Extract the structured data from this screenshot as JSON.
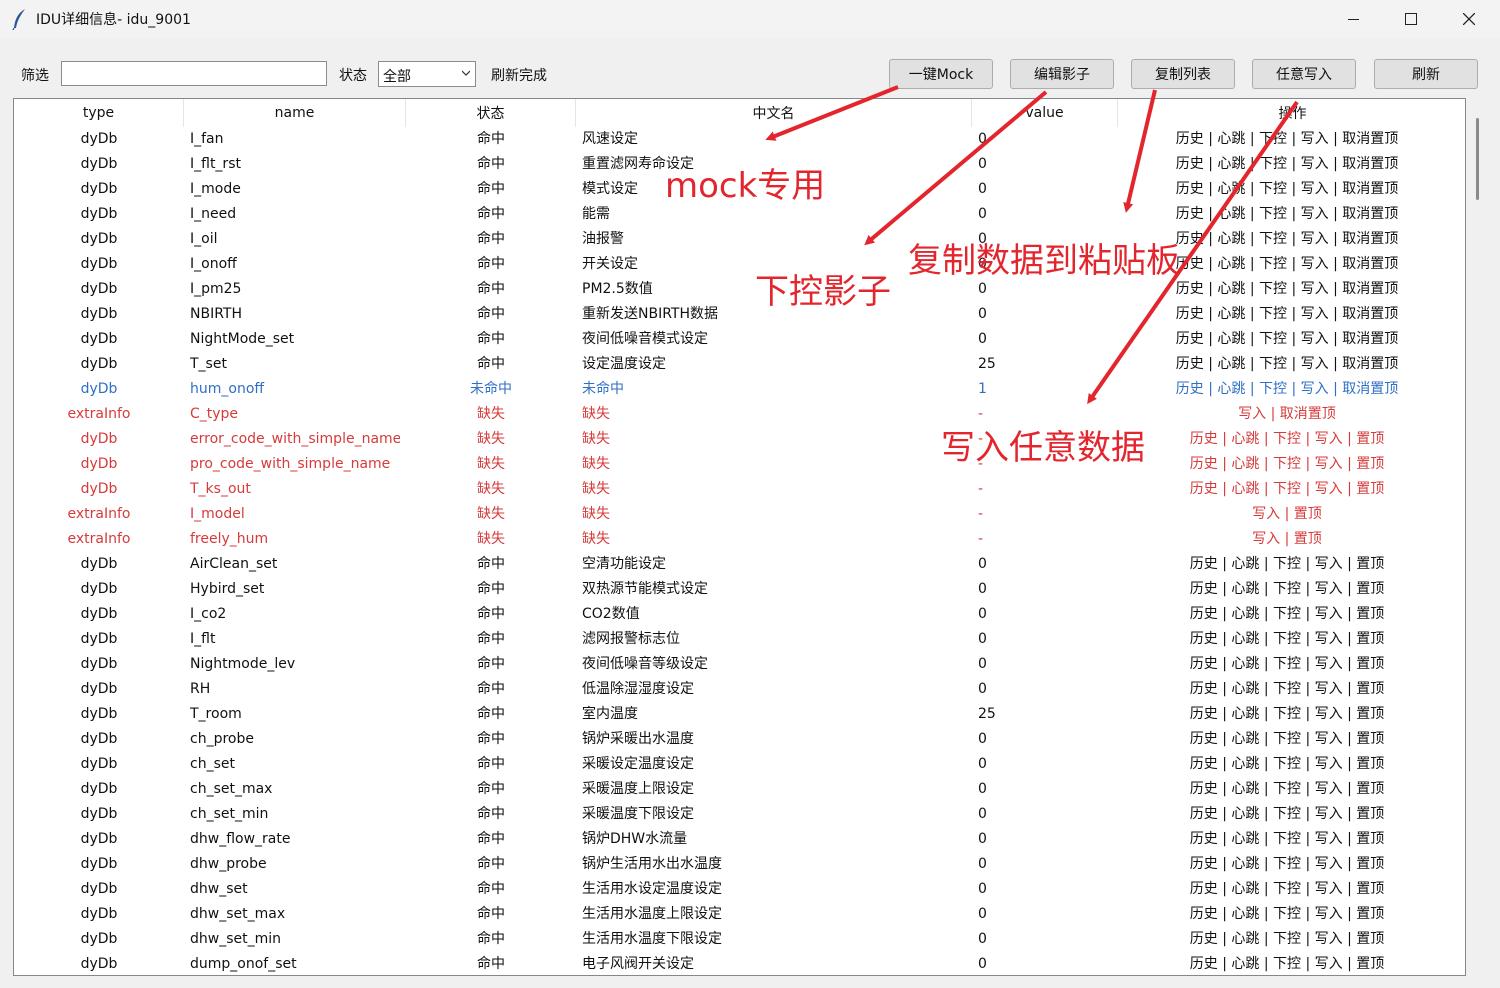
{
  "window": {
    "title": "IDU详细信息- idu_9001"
  },
  "toolbar": {
    "filter_label": "筛选",
    "filter_value": "",
    "state_label": "状态",
    "state_value": "全部",
    "status_text": "刷新完成",
    "buttons": [
      "一键Mock",
      "编辑影子",
      "复制列表",
      "任意写入",
      "刷新"
    ]
  },
  "table": {
    "headers": [
      "type",
      "name",
      "状态",
      "中文名",
      "value",
      "操作"
    ],
    "rows": [
      {
        "type": "dyDb",
        "name": "I_fan",
        "state": "命中",
        "cn": "风速设定",
        "value": "0",
        "ops": "历史 | 心跳 | 下控 | 写入 | 取消置顶",
        "status": "hit"
      },
      {
        "type": "dyDb",
        "name": "I_flt_rst",
        "state": "命中",
        "cn": "重置滤网寿命设定",
        "value": "0",
        "ops": "历史 | 心跳 | 下控 | 写入 | 取消置顶",
        "status": "hit"
      },
      {
        "type": "dyDb",
        "name": "I_mode",
        "state": "命中",
        "cn": "模式设定",
        "value": "0",
        "ops": "历史 | 心跳 | 下控 | 写入 | 取消置顶",
        "status": "hit"
      },
      {
        "type": "dyDb",
        "name": "I_need",
        "state": "命中",
        "cn": "能需",
        "value": "0",
        "ops": "历史 | 心跳 | 下控 | 写入 | 取消置顶",
        "status": "hit"
      },
      {
        "type": "dyDb",
        "name": "I_oil",
        "state": "命中",
        "cn": "油报警",
        "value": "0",
        "ops": "历史 | 心跳 | 下控 | 写入 | 取消置顶",
        "status": "hit"
      },
      {
        "type": "dyDb",
        "name": "I_onoff",
        "state": "命中",
        "cn": "开关设定",
        "value": "0",
        "ops": "历史 | 心跳 | 下控 | 写入 | 取消置顶",
        "status": "hit"
      },
      {
        "type": "dyDb",
        "name": "I_pm25",
        "state": "命中",
        "cn": "PM2.5数值",
        "value": "0",
        "ops": "历史 | 心跳 | 下控 | 写入 | 取消置顶",
        "status": "hit"
      },
      {
        "type": "dyDb",
        "name": "NBIRTH",
        "state": "命中",
        "cn": "重新发送NBIRTH数据",
        "value": "0",
        "ops": "历史 | 心跳 | 下控 | 写入 | 取消置顶",
        "status": "hit"
      },
      {
        "type": "dyDb",
        "name": "NightMode_set",
        "state": "命中",
        "cn": "夜间低噪音模式设定",
        "value": "0",
        "ops": "历史 | 心跳 | 下控 | 写入 | 取消置顶",
        "status": "hit"
      },
      {
        "type": "dyDb",
        "name": "T_set",
        "state": "命中",
        "cn": "设定温度设定",
        "value": "25",
        "ops": "历史 | 心跳 | 下控 | 写入 | 取消置顶",
        "status": "hit"
      },
      {
        "type": "dyDb",
        "name": "hum_onoff",
        "state": "未命中",
        "cn": "未命中",
        "value": "1",
        "ops": "历史 | 心跳 | 下控 | 写入 | 取消置顶",
        "status": "unhit"
      },
      {
        "type": "extraInfo",
        "name": "C_type",
        "state": "缺失",
        "cn": "缺失",
        "value": "-",
        "ops": "写入 | 取消置顶",
        "status": "miss"
      },
      {
        "type": "dyDb",
        "name": "error_code_with_simple_name",
        "state": "缺失",
        "cn": "缺失",
        "value": "-",
        "ops": "历史 | 心跳 | 下控 | 写入 | 置顶",
        "status": "miss"
      },
      {
        "type": "dyDb",
        "name": "pro_code_with_simple_name",
        "state": "缺失",
        "cn": "缺失",
        "value": "-",
        "ops": "历史 | 心跳 | 下控 | 写入 | 置顶",
        "status": "miss"
      },
      {
        "type": "dyDb",
        "name": "T_ks_out",
        "state": "缺失",
        "cn": "缺失",
        "value": "-",
        "ops": "历史 | 心跳 | 下控 | 写入 | 置顶",
        "status": "miss"
      },
      {
        "type": "extraInfo",
        "name": "I_model",
        "state": "缺失",
        "cn": "缺失",
        "value": "-",
        "ops": "写入 | 置顶",
        "status": "miss"
      },
      {
        "type": "extraInfo",
        "name": "freely_hum",
        "state": "缺失",
        "cn": "缺失",
        "value": "-",
        "ops": "写入 | 置顶",
        "status": "miss"
      },
      {
        "type": "dyDb",
        "name": "AirClean_set",
        "state": "命中",
        "cn": "空清功能设定",
        "value": "0",
        "ops": "历史 | 心跳 | 下控 | 写入 | 置顶",
        "status": "hit"
      },
      {
        "type": "dyDb",
        "name": "Hybird_set",
        "state": "命中",
        "cn": "双热源节能模式设定",
        "value": "0",
        "ops": "历史 | 心跳 | 下控 | 写入 | 置顶",
        "status": "hit"
      },
      {
        "type": "dyDb",
        "name": "I_co2",
        "state": "命中",
        "cn": "CO2数值",
        "value": "0",
        "ops": "历史 | 心跳 | 下控 | 写入 | 置顶",
        "status": "hit"
      },
      {
        "type": "dyDb",
        "name": "I_flt",
        "state": "命中",
        "cn": "滤网报警标志位",
        "value": "0",
        "ops": "历史 | 心跳 | 下控 | 写入 | 置顶",
        "status": "hit"
      },
      {
        "type": "dyDb",
        "name": "Nightmode_lev",
        "state": "命中",
        "cn": "夜间低噪音等级设定",
        "value": "0",
        "ops": "历史 | 心跳 | 下控 | 写入 | 置顶",
        "status": "hit"
      },
      {
        "type": "dyDb",
        "name": "RH",
        "state": "命中",
        "cn": "低温除湿湿度设定",
        "value": "0",
        "ops": "历史 | 心跳 | 下控 | 写入 | 置顶",
        "status": "hit"
      },
      {
        "type": "dyDb",
        "name": "T_room",
        "state": "命中",
        "cn": "室内温度",
        "value": "25",
        "ops": "历史 | 心跳 | 下控 | 写入 | 置顶",
        "status": "hit"
      },
      {
        "type": "dyDb",
        "name": "ch_probe",
        "state": "命中",
        "cn": "锅炉采暖出水温度",
        "value": "0",
        "ops": "历史 | 心跳 | 下控 | 写入 | 置顶",
        "status": "hit"
      },
      {
        "type": "dyDb",
        "name": "ch_set",
        "state": "命中",
        "cn": "采暖设定温度设定",
        "value": "0",
        "ops": "历史 | 心跳 | 下控 | 写入 | 置顶",
        "status": "hit"
      },
      {
        "type": "dyDb",
        "name": "ch_set_max",
        "state": "命中",
        "cn": "采暖温度上限设定",
        "value": "0",
        "ops": "历史 | 心跳 | 下控 | 写入 | 置顶",
        "status": "hit"
      },
      {
        "type": "dyDb",
        "name": "ch_set_min",
        "state": "命中",
        "cn": "采暖温度下限设定",
        "value": "0",
        "ops": "历史 | 心跳 | 下控 | 写入 | 置顶",
        "status": "hit"
      },
      {
        "type": "dyDb",
        "name": "dhw_flow_rate",
        "state": "命中",
        "cn": "锅炉DHW水流量",
        "value": "0",
        "ops": "历史 | 心跳 | 下控 | 写入 | 置顶",
        "status": "hit"
      },
      {
        "type": "dyDb",
        "name": "dhw_probe",
        "state": "命中",
        "cn": "锅炉生活用水出水温度",
        "value": "0",
        "ops": "历史 | 心跳 | 下控 | 写入 | 置顶",
        "status": "hit"
      },
      {
        "type": "dyDb",
        "name": "dhw_set",
        "state": "命中",
        "cn": "生活用水设定温度设定",
        "value": "0",
        "ops": "历史 | 心跳 | 下控 | 写入 | 置顶",
        "status": "hit"
      },
      {
        "type": "dyDb",
        "name": "dhw_set_max",
        "state": "命中",
        "cn": "生活用水温度上限设定",
        "value": "0",
        "ops": "历史 | 心跳 | 下控 | 写入 | 置顶",
        "status": "hit"
      },
      {
        "type": "dyDb",
        "name": "dhw_set_min",
        "state": "命中",
        "cn": "生活用水温度下限设定",
        "value": "0",
        "ops": "历史 | 心跳 | 下控 | 写入 | 置顶",
        "status": "hit"
      },
      {
        "type": "dyDb",
        "name": "dump_onof_set",
        "state": "命中",
        "cn": "电子风阀开关设定",
        "value": "0",
        "ops": "历史 | 心跳 | 下控 | 写入 | 置顶",
        "status": "hit"
      }
    ]
  },
  "annotations": {
    "mock": "mock专用",
    "shadow": "下控影子",
    "copy": "复制数据到粘贴板",
    "write": "写入任意数据",
    "color": "#e3262d"
  },
  "colors": {
    "missing": "#d73a3a",
    "unhit": "#2f6fc4",
    "annotation": "#e3262d"
  }
}
